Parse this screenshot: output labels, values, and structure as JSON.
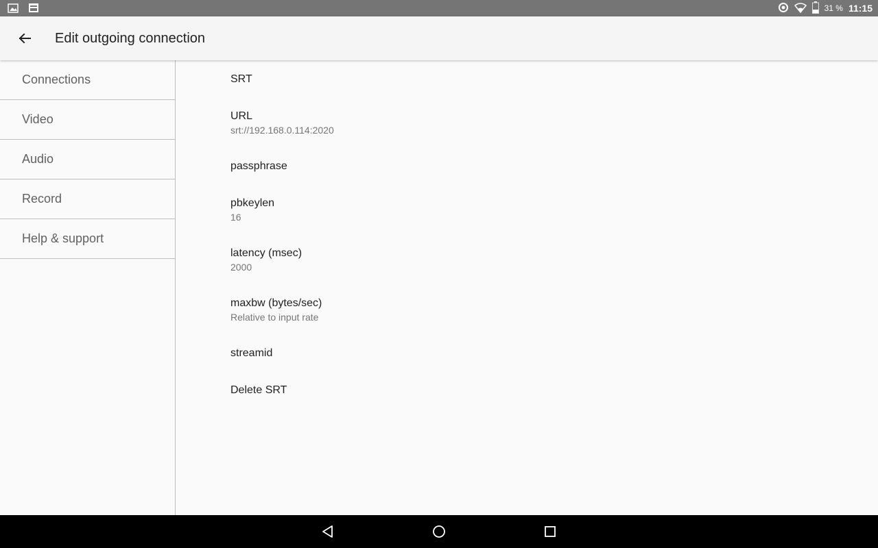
{
  "status_bar": {
    "notification_icons": [
      "image-icon",
      "cast-screen-icon"
    ],
    "system_icons": [
      "data-saver-icon",
      "wifi-icon",
      "battery-icon"
    ],
    "battery": "31 %",
    "time": "11:15"
  },
  "app_bar": {
    "back_icon": "arrow-back-icon",
    "title": "Edit outgoing connection"
  },
  "sidebar": {
    "items": [
      {
        "label": "Connections"
      },
      {
        "label": "Video"
      },
      {
        "label": "Audio"
      },
      {
        "label": "Record"
      },
      {
        "label": "Help & support"
      }
    ]
  },
  "preferences": [
    {
      "title": "SRT",
      "summary": ""
    },
    {
      "title": "URL",
      "summary": "srt://192.168.0.114:2020"
    },
    {
      "title": "passphrase",
      "summary": ""
    },
    {
      "title": "pbkeylen",
      "summary": "16"
    },
    {
      "title": "latency (msec)",
      "summary": "2000"
    },
    {
      "title": "maxbw (bytes/sec)",
      "summary": "Relative to input rate"
    },
    {
      "title": "streamid",
      "summary": ""
    },
    {
      "title": "Delete SRT",
      "summary": ""
    }
  ],
  "nav_bar": {
    "back": "nav-back-icon",
    "home": "nav-home-icon",
    "recents": "nav-recents-icon"
  }
}
